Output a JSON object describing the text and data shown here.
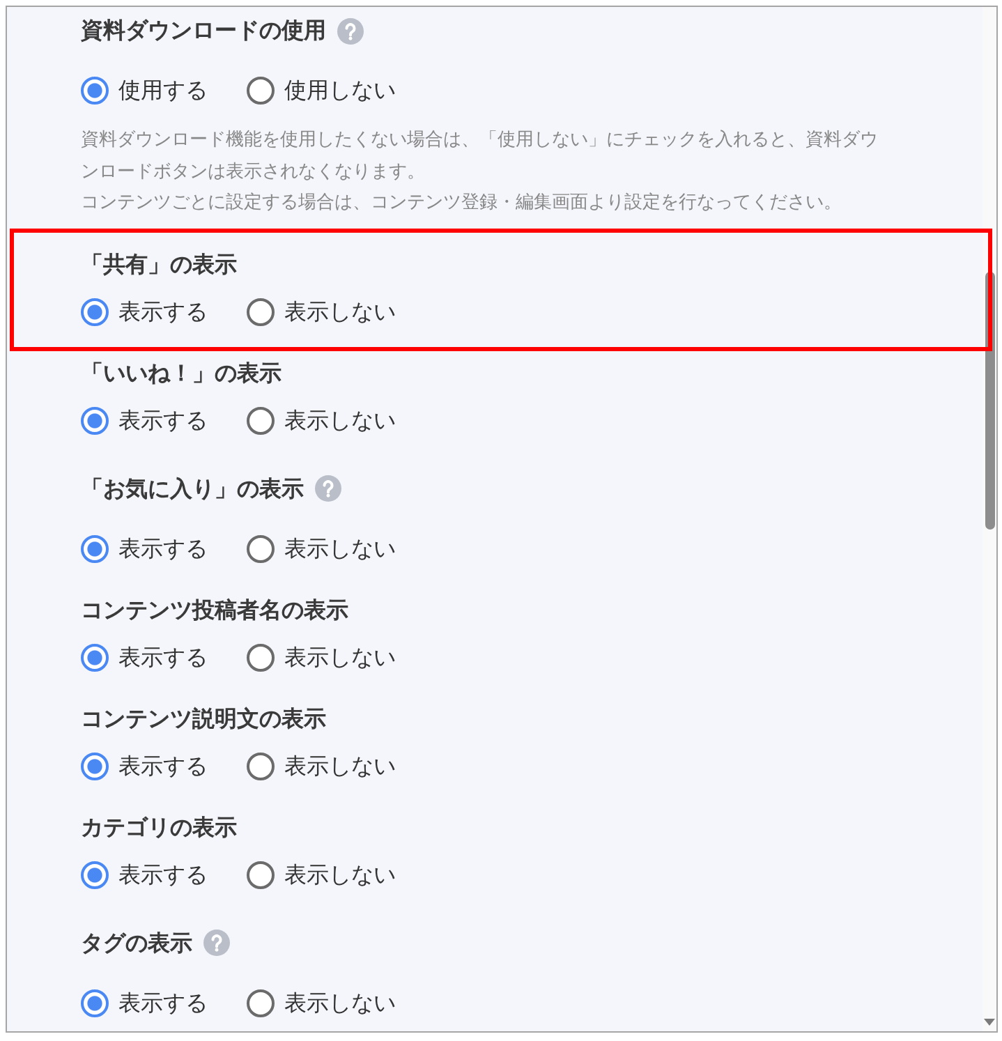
{
  "settings": [
    {
      "title": "資料ダウンロードの使用",
      "help": true,
      "highlighted": false,
      "options": [
        {
          "label": "使用する",
          "selected": true
        },
        {
          "label": "使用しない",
          "selected": false
        }
      ],
      "notes": [
        "資料ダウンロード機能を使用したくない場合は、「使用しない」にチェックを入れると、資料ダウンロードボタンは表示されなくなります。",
        "コンテンツごとに設定する場合は、コンテンツ登録・編集画面より設定を行なってください。"
      ]
    },
    {
      "title": "「共有」の表示",
      "help": false,
      "highlighted": true,
      "options": [
        {
          "label": "表示する",
          "selected": true
        },
        {
          "label": "表示しない",
          "selected": false
        }
      ]
    },
    {
      "title": "「いいね！」の表示",
      "help": false,
      "highlighted": false,
      "options": [
        {
          "label": "表示する",
          "selected": true
        },
        {
          "label": "表示しない",
          "selected": false
        }
      ]
    },
    {
      "title": "「お気に入り」の表示",
      "help": true,
      "highlighted": false,
      "options": [
        {
          "label": "表示する",
          "selected": true
        },
        {
          "label": "表示しない",
          "selected": false
        }
      ]
    },
    {
      "title": "コンテンツ投稿者名の表示",
      "help": false,
      "highlighted": false,
      "options": [
        {
          "label": "表示する",
          "selected": true
        },
        {
          "label": "表示しない",
          "selected": false
        }
      ]
    },
    {
      "title": "コンテンツ説明文の表示",
      "help": false,
      "highlighted": false,
      "options": [
        {
          "label": "表示する",
          "selected": true
        },
        {
          "label": "表示しない",
          "selected": false
        }
      ]
    },
    {
      "title": "カテゴリの表示",
      "help": false,
      "highlighted": false,
      "options": [
        {
          "label": "表示する",
          "selected": true
        },
        {
          "label": "表示しない",
          "selected": false
        }
      ]
    },
    {
      "title": "タグの表示",
      "help": true,
      "highlighted": false,
      "options": [
        {
          "label": "表示する",
          "selected": true
        },
        {
          "label": "表示しない",
          "selected": false
        }
      ]
    }
  ]
}
